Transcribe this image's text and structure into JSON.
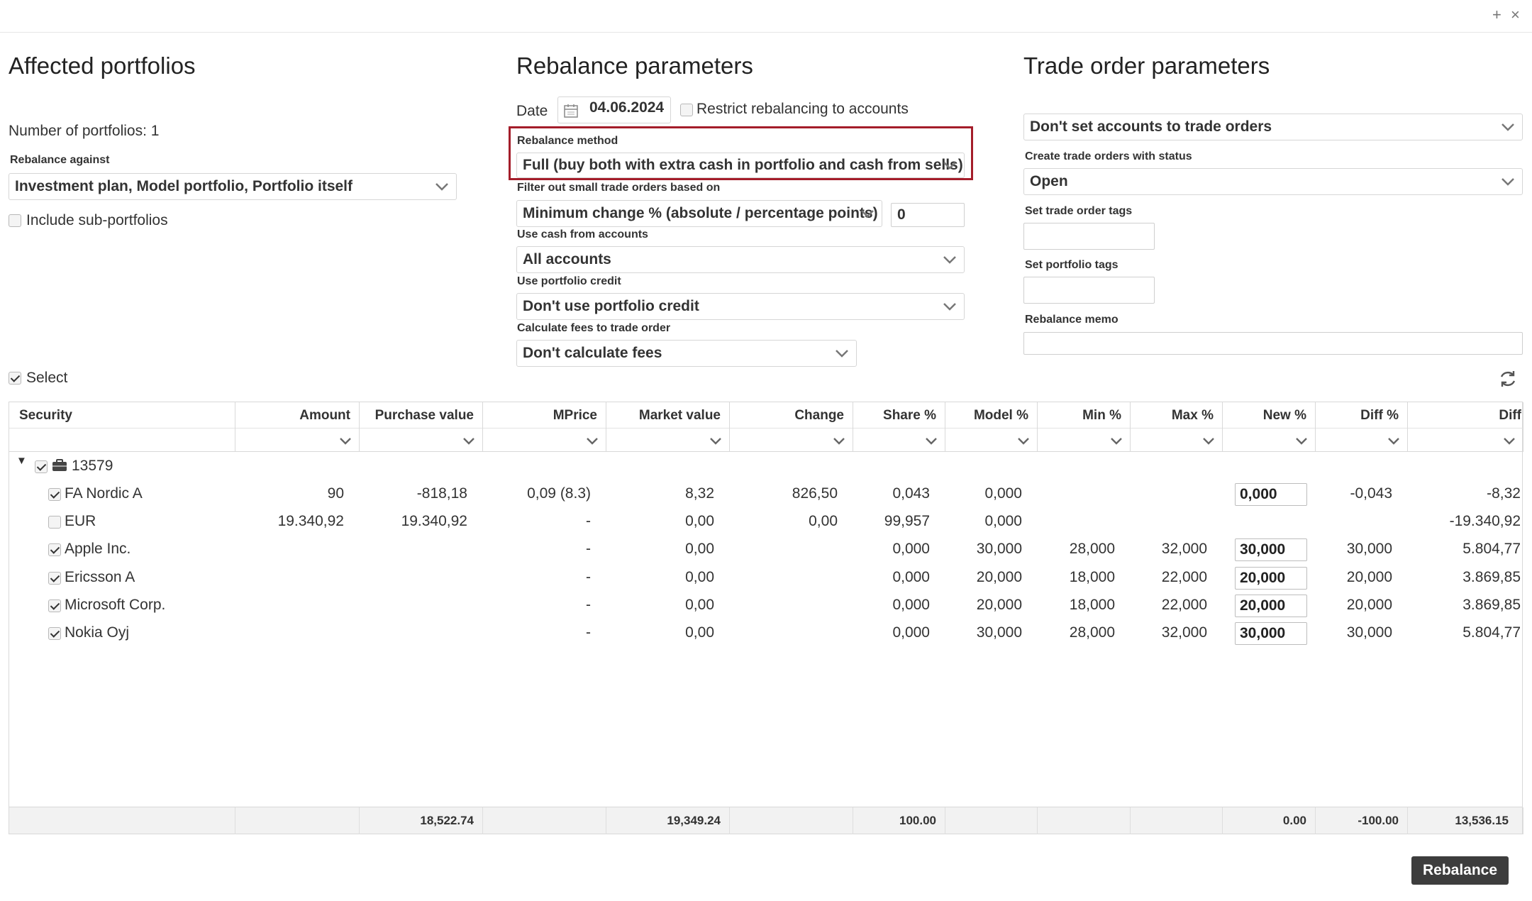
{
  "window": {
    "plus_icon": "+",
    "close_icon": "×"
  },
  "affected": {
    "title": "Affected portfolios",
    "count_label": "Number of portfolios: 1",
    "rebalance_against_label": "Rebalance against",
    "rebalance_against_value": "Investment plan, Model portfolio, Portfolio itself",
    "include_sub_label": "Include sub-portfolios"
  },
  "rebalance": {
    "title": "Rebalance parameters",
    "date_label": "Date",
    "date_value": "04.06.2024",
    "restrict_label": "Restrict rebalancing to accounts",
    "method_label": "Rebalance method",
    "method_value": "Full (buy both with extra cash in portfolio and cash from sells)",
    "filter_label": "Filter out small trade orders based on",
    "filter_value": "Minimum change % (absolute / percentage points)",
    "filter_threshold": "0",
    "cash_label": "Use cash from accounts",
    "cash_value": "All accounts",
    "credit_label": "Use portfolio credit",
    "credit_value": "Don't use portfolio credit",
    "fees_label": "Calculate fees to trade order",
    "fees_value": "Don't calculate fees"
  },
  "trade": {
    "title": "Trade order parameters",
    "accounts_value": "Don't set accounts to trade orders",
    "status_label": "Create trade orders with status",
    "status_value": "Open",
    "order_tags_label": "Set trade order tags",
    "portfolio_tags_label": "Set portfolio tags",
    "memo_label": "Rebalance memo"
  },
  "select_label": "Select",
  "table": {
    "columns": [
      "Security",
      "Amount",
      "Purchase value",
      "MPrice",
      "Market value",
      "Change",
      "Share %",
      "Model %",
      "Min %",
      "Max %",
      "New %",
      "Diff %",
      "Diff"
    ],
    "group": "13579",
    "rows": [
      {
        "name": "FA Nordic A",
        "checked": true,
        "amount": "90",
        "purchase": "-818,18",
        "mprice": "0,09 (8.3)",
        "market": "8,32",
        "change": "826,50",
        "share": "0,043",
        "model": "0,000",
        "min": "",
        "max": "",
        "newp": "0,000",
        "diffp": "-0,043",
        "diff": "-8,32"
      },
      {
        "name": "EUR",
        "checked": false,
        "amount": "19.340,92",
        "purchase": "19.340,92",
        "mprice": "-",
        "market": "0,00",
        "change": "0,00",
        "share": "99,957",
        "model": "0,000",
        "min": "",
        "max": "",
        "newp": "",
        "diffp": "",
        "diff": "-19.340,92"
      },
      {
        "name": "Apple Inc.",
        "checked": true,
        "amount": "",
        "purchase": "",
        "mprice": "-",
        "market": "0,00",
        "change": "",
        "share": "0,000",
        "model": "30,000",
        "min": "28,000",
        "max": "32,000",
        "newp": "30,000",
        "diffp": "30,000",
        "diff": "5.804,77"
      },
      {
        "name": "Ericsson A",
        "checked": true,
        "amount": "",
        "purchase": "",
        "mprice": "-",
        "market": "0,00",
        "change": "",
        "share": "0,000",
        "model": "20,000",
        "min": "18,000",
        "max": "22,000",
        "newp": "20,000",
        "diffp": "20,000",
        "diff": "3.869,85"
      },
      {
        "name": "Microsoft Corp.",
        "checked": true,
        "amount": "",
        "purchase": "",
        "mprice": "-",
        "market": "0,00",
        "change": "",
        "share": "0,000",
        "model": "20,000",
        "min": "18,000",
        "max": "22,000",
        "newp": "20,000",
        "diffp": "20,000",
        "diff": "3.869,85"
      },
      {
        "name": "Nokia Oyj",
        "checked": true,
        "amount": "",
        "purchase": "",
        "mprice": "-",
        "market": "0,00",
        "change": "",
        "share": "0,000",
        "model": "30,000",
        "min": "28,000",
        "max": "32,000",
        "newp": "30,000",
        "diffp": "30,000",
        "diff": "5.804,77"
      }
    ],
    "totals": {
      "purchase": "18,522.74",
      "market": "19,349.24",
      "share": "100.00",
      "newp": "0.00",
      "diffp": "-100.00",
      "diff": "13,536.15"
    }
  },
  "rebalance_button": "Rebalance"
}
